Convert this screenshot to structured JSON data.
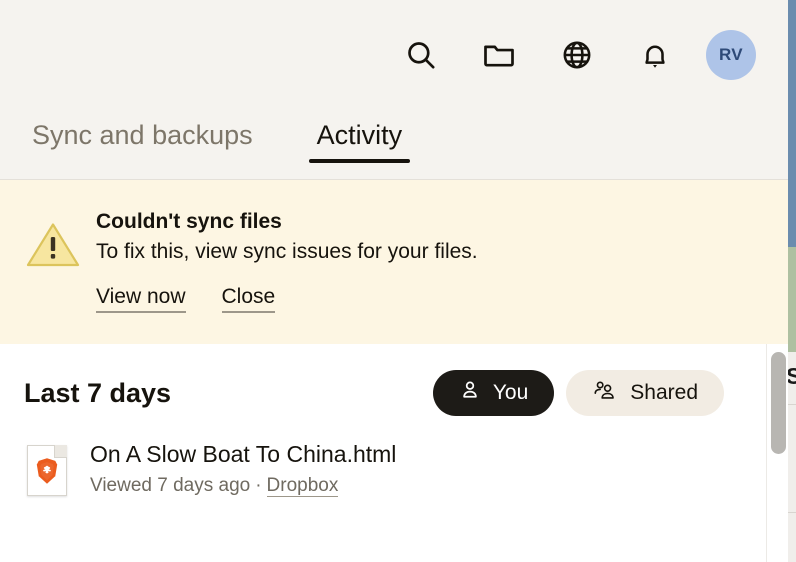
{
  "window": {
    "background_peek": {
      "blue": "#6b8cae",
      "green": "#aec0a1",
      "gray": "#f0eeeb",
      "clipped_letter": "S"
    }
  },
  "header": {
    "background": "#f5f3ef",
    "icons": [
      {
        "name": "search-icon",
        "label": "Search"
      },
      {
        "name": "folder-icon",
        "label": "Files"
      },
      {
        "name": "globe-icon",
        "label": "Web"
      },
      {
        "name": "bell-icon",
        "label": "Notifications"
      }
    ],
    "avatar": {
      "initials": "RV",
      "background": "#aec4e8",
      "text_color": "#2e4a78"
    }
  },
  "tabs": {
    "active_index": 1,
    "items": [
      {
        "label": "Sync and backups",
        "active": false
      },
      {
        "label": "Activity",
        "active": true
      }
    ],
    "active_underline_color": "#16130d"
  },
  "banner": {
    "type": "warning",
    "background": "#fdf6e3",
    "icon": "warning-triangle-icon",
    "icon_fill": "#f7e6a0",
    "icon_stroke": "#d9bf52",
    "title": "Couldn't sync files",
    "message": "To fix this, view sync issues for your files.",
    "actions": [
      {
        "label": "View now",
        "name": "view-now-link"
      },
      {
        "label": "Close",
        "name": "close-link"
      }
    ]
  },
  "activity": {
    "section_title": "Last 7 days",
    "filters": [
      {
        "label": "You",
        "icon": "person-icon",
        "selected": true
      },
      {
        "label": "Shared",
        "icon": "people-icon",
        "selected": false
      }
    ],
    "selected_pill_bg": "#1d1b17",
    "unselected_pill_bg": "#f2ece3",
    "items": [
      {
        "name": "On A Slow Boat To China.html",
        "icon": "html-file-brave-icon",
        "status": "Viewed 7 days ago",
        "separator": "·",
        "source": "Dropbox"
      }
    ]
  },
  "scrollbar": {
    "thumb_color": "#b8b6b2"
  }
}
